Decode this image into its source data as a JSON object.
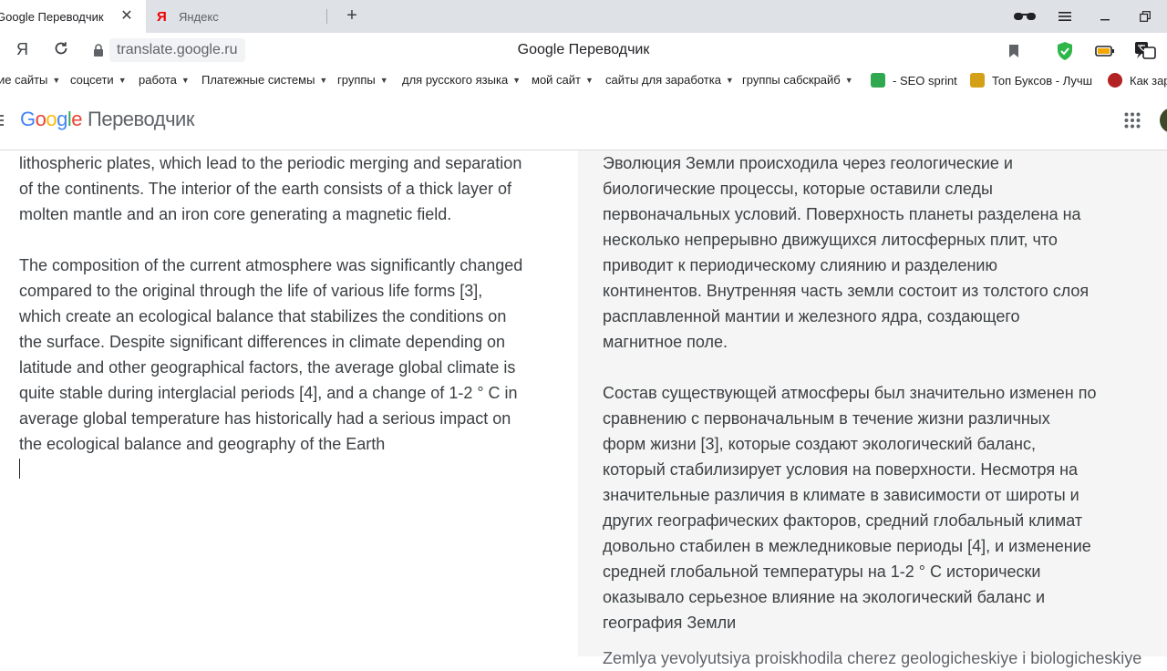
{
  "tabs": [
    {
      "title": "Google Переводчик",
      "active": true
    },
    {
      "title": "Яндекс",
      "favicon": "Я",
      "active": false
    }
  ],
  "new_tab_symbol": "+",
  "close_symbol": "✕",
  "address_bar": {
    "ya_symbol": "Я",
    "url": "translate.google.ru",
    "page_title": "Google Переводчик"
  },
  "bookmarks": [
    {
      "label": "ие сайты",
      "dropdown": true
    },
    {
      "label": "соцсети",
      "dropdown": true
    },
    {
      "label": "работа",
      "dropdown": true
    },
    {
      "label": "Платежные системы",
      "dropdown": true
    },
    {
      "label": "группы",
      "dropdown": true
    },
    {
      "label": "для русского языка",
      "dropdown": true
    },
    {
      "label": "мой сайт",
      "dropdown": true
    },
    {
      "label": "сайты для заработка",
      "dropdown": true
    },
    {
      "label": "группы сабскрайб",
      "dropdown": true
    },
    {
      "label": "- SEO sprint",
      "dropdown": false
    },
    {
      "label": "Топ Буксов - Лучш",
      "dropdown": false
    },
    {
      "label": "Как зар",
      "dropdown": false
    }
  ],
  "translate_header": {
    "logo_letters": [
      "G",
      "o",
      "o",
      "g",
      "l",
      "e"
    ],
    "product": "Переводчик"
  },
  "source": {
    "paragraphs": [
      "lithospheric plates, which lead to the periodic merging and separation\nof the continents. The interior of the earth consists of a thick layer of\nmolten mantle and an iron core generating a magnetic field.",
      "The composition of the current atmosphere was significantly changed\ncompared to the original through the life of various life forms [3],\nwhich create an ecological balance that stabilizes the conditions on\nthe surface. Despite significant differences in climate depending on\nlatitude and other geographical factors, the average global climate is\nquite stable during interglacial periods [4], and a change of 1-2 ° C in\naverage global temperature has historically had a serious impact on\nthe ecological balance and geography of the Earth"
    ]
  },
  "target": {
    "paragraphs": [
      "Эволюция Земли происходила через геологические и\nбиологические процессы, которые оставили следы\nпервоначальных условий. Поверхность планеты разделена на\nнесколько непрерывно движущихся литосферных плит, что\nприводит к периодическому слиянию и разделению\nконтинентов. Внутренняя часть земли состоит из толстого слоя\nрасплавленной мантии и железного ядра, создающего\nмагнитное поле.",
      "Состав существующей атмосферы был значительно изменен по\nсравнению с первоначальным в течение жизни различных\nформ жизни [3], которые создают экологический баланс,\nкоторый стабилизирует условия на поверхности. Несмотря на\nзначительные различия в климате в зависимости от широты и\nдругих географических факторов, средний глобальный климат\nдовольно стабилен в межледниковые периоды [4], и изменение\nсредней глобальной температуры на 1-2 ° C исторически\nоказывало серьезное влияние на экологический баланс и\nгеография Земли"
    ],
    "cut_off_line": "Zemlya yevolyutsiya proiskhodila cherez geologicheskiye i biologicheskiye"
  },
  "colors": {
    "tabstrip": "#dee1e6",
    "target_panel": "#f5f5f5",
    "text": "#3c4043",
    "shield": "#2fb648"
  }
}
